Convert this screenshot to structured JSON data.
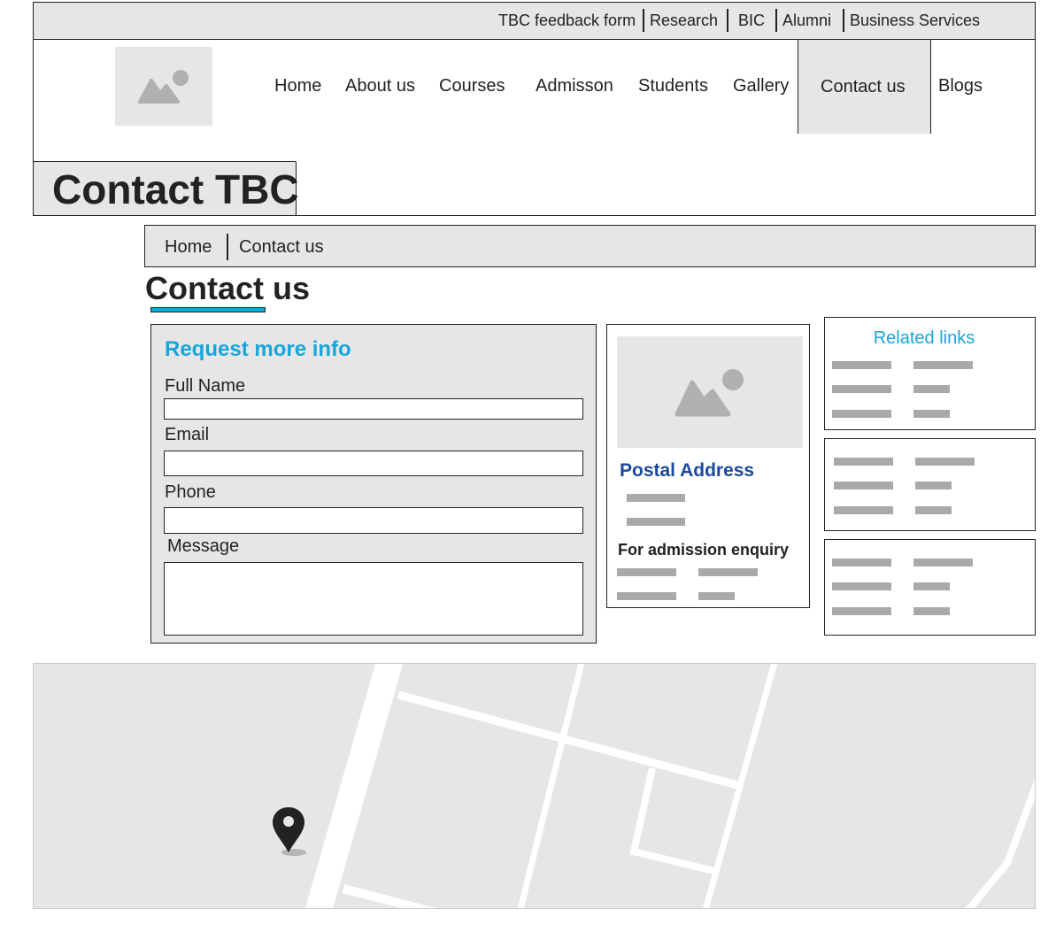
{
  "top_links": [
    "TBC feedback form",
    "Research",
    "BIC",
    "Alumni",
    "Business Services"
  ],
  "nav": {
    "items": [
      "Home",
      "About us",
      "Courses",
      "Admisson",
      "Students",
      "Gallery",
      "Contact us",
      "Blogs"
    ],
    "active": "Contact us"
  },
  "hero": {
    "title": "Contact TBC"
  },
  "breadcrumb": {
    "items": [
      "Home",
      "Contact us"
    ]
  },
  "page": {
    "title": "Contact us"
  },
  "form": {
    "heading": "Request more info",
    "fields": [
      {
        "label": "Full Name",
        "value": ""
      },
      {
        "label": "Email",
        "value": ""
      },
      {
        "label": "Phone",
        "value": ""
      },
      {
        "label": "Message",
        "value": ""
      }
    ]
  },
  "postal": {
    "title": "Postal Address",
    "enquiry_label": "For admission enquiry"
  },
  "related": {
    "title": "Related links"
  },
  "colors": {
    "accent": "#17a6dc",
    "postal_title": "#1a4a9c",
    "panel_gray": "#e6e6e6",
    "placeholder_bar": "#a9a9a9"
  },
  "icons": {
    "logo": "image-placeholder-icon",
    "postal_image": "image-placeholder-icon",
    "map_pin": "map-pin-icon"
  }
}
